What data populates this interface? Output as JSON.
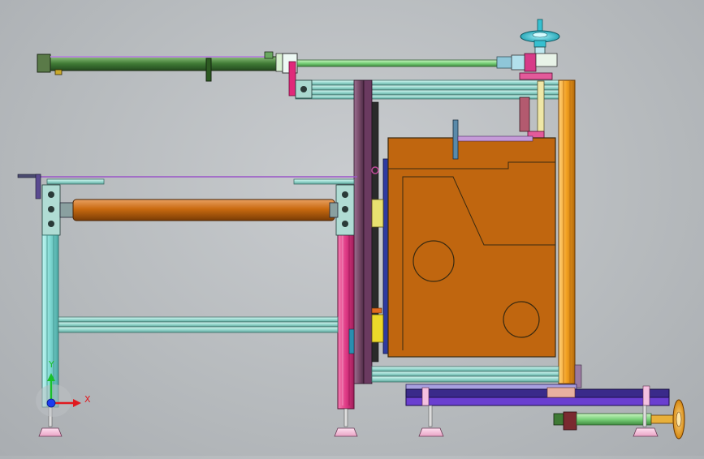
{
  "viewport": {
    "background": "#c3c6c9"
  },
  "triad": {
    "x_label": "X",
    "y_label": "Y",
    "x_color": "#e0191f",
    "y_color": "#19c02a",
    "z_color": "#1a3cf0"
  },
  "colors": {
    "cabinet": "#c0660f",
    "cabinet_outline": "#3a2a10",
    "roller": "#c96a10",
    "frame_cyan": "#8fe0dc",
    "frame_teal": "#9fdcd2",
    "pillar_pink": "#e43d8c",
    "pillar_purple": "#8a5a7a",
    "column_orange": "#f4a020",
    "cylinder_green": "#4a8a3a",
    "rod_green": "#8de08a",
    "handwheel_cyan": "#36c0d0",
    "handwheel_orange": "#f0a020",
    "base_blue": "#3a2a8a",
    "foot_pink": "#f2b8d6"
  },
  "icons": {
    "top_handwheel": "handwheel-icon",
    "bottom_handwheel": "handwheel-icon",
    "triad": "axis-triad-icon"
  }
}
